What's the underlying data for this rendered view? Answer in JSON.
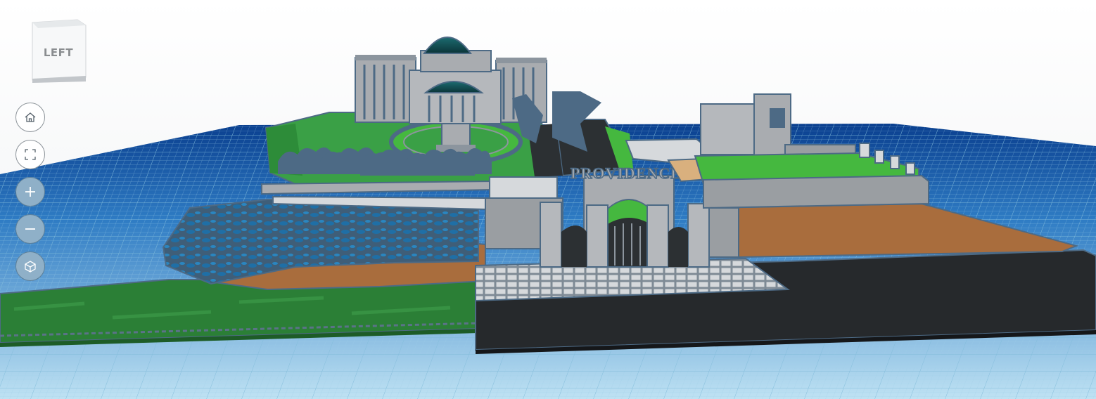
{
  "view_cube": {
    "face_label": "LEFT"
  },
  "nav_controls": [
    {
      "name": "home-view-button",
      "icon": "home-icon"
    },
    {
      "name": "fit-view-button",
      "icon": "fit-frame-icon"
    },
    {
      "name": "zoom-in-button",
      "icon": "plus-icon"
    },
    {
      "name": "zoom-out-button",
      "icon": "minus-icon"
    },
    {
      "name": "perspective-toggle-button",
      "icon": "cube-perspective-icon"
    }
  ],
  "scene": {
    "sign_text": "PROVIDENCE",
    "colors": {
      "workplane": "#c3e3f3",
      "grid_line": "#8dc7e3",
      "horizon": "#0a3f8f",
      "grass": "#2e8a3c",
      "bright_grass": "#45b83f",
      "dirt": "#a96d3d",
      "dark_slab": "#26292c",
      "stone": "#a9acb0",
      "structure_blue": "#4d6a85",
      "water": "#1f6fa6",
      "dome": "#0f4a4f"
    }
  }
}
